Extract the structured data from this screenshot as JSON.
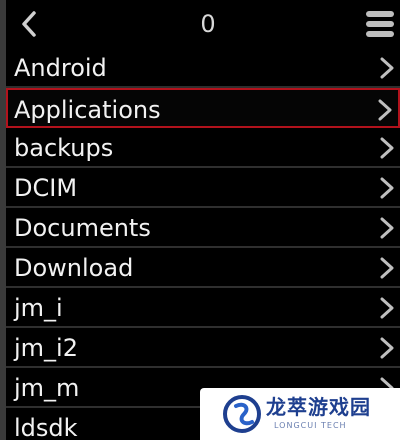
{
  "header": {
    "back_icon": "chevron-left-icon",
    "count": "0",
    "menu_icon": "hamburger-menu-icon"
  },
  "folders": [
    {
      "name": "Android",
      "selected": false
    },
    {
      "name": "Applications",
      "selected": true
    },
    {
      "name": "backups",
      "selected": false
    },
    {
      "name": "DCIM",
      "selected": false
    },
    {
      "name": "Documents",
      "selected": false
    },
    {
      "name": "Download",
      "selected": false
    },
    {
      "name": "jm_i",
      "selected": false
    },
    {
      "name": "jm_i2",
      "selected": false
    },
    {
      "name": "jm_m",
      "selected": false
    },
    {
      "name": "ldsdk",
      "selected": false
    }
  ],
  "colors": {
    "background": "#000000",
    "selection_border": "#b2121c",
    "divider": "#2f2f2f",
    "text": "#f2f2f2"
  },
  "watermark": {
    "title": "龙萃游戏园",
    "subtitle": "LONGCUI TECH"
  }
}
